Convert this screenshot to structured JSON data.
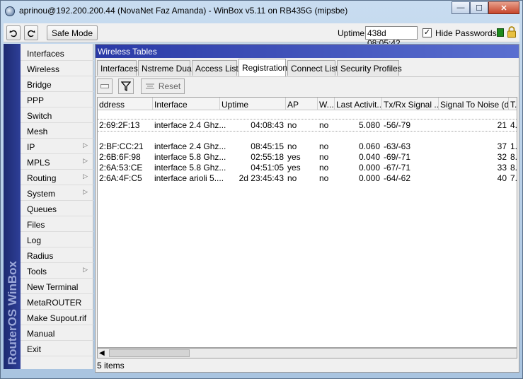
{
  "window": {
    "title": "aprinou@192.200.200.44 (NovaNet Faz Amanda) - WinBox v5.11 on RB435G (mipsbe)",
    "minimize": "—",
    "maximize": "☐",
    "close": "✕"
  },
  "toolbar": {
    "undo_icon": "undo-icon",
    "redo_icon": "redo-icon",
    "safe_mode": "Safe Mode",
    "uptime_label": "Uptime:",
    "uptime_value": "438d 08:05:42",
    "hide_passwords_checked": true,
    "hide_passwords": "Hide Passwords",
    "checkmark": "✓"
  },
  "sidebar": {
    "brand": "RouterOS WinBox",
    "items": [
      {
        "label": "Interfaces",
        "submenu": false
      },
      {
        "label": "Wireless",
        "submenu": false
      },
      {
        "label": "Bridge",
        "submenu": false
      },
      {
        "label": "PPP",
        "submenu": false
      },
      {
        "label": "Switch",
        "submenu": false
      },
      {
        "label": "Mesh",
        "submenu": false
      },
      {
        "label": "IP",
        "submenu": true
      },
      {
        "label": "MPLS",
        "submenu": true
      },
      {
        "label": "Routing",
        "submenu": true
      },
      {
        "label": "System",
        "submenu": true
      },
      {
        "label": "Queues",
        "submenu": false
      },
      {
        "label": "Files",
        "submenu": false
      },
      {
        "label": "Log",
        "submenu": false
      },
      {
        "label": "Radius",
        "submenu": false
      },
      {
        "label": "Tools",
        "submenu": true
      },
      {
        "label": "New Terminal",
        "submenu": false
      },
      {
        "label": "MetaROUTER",
        "submenu": false
      },
      {
        "label": "Make Supout.rif",
        "submenu": false
      },
      {
        "label": "Manual",
        "submenu": false
      },
      {
        "label": "Exit",
        "submenu": false
      }
    ],
    "submenu_arrow": "▷"
  },
  "panel": {
    "title": "Wireless Tables",
    "tabs": [
      "Interfaces",
      "Nstreme Dual",
      "Access List",
      "Registration",
      "Connect List",
      "Security Profiles"
    ],
    "active_tab": "Registration",
    "reset": "Reset",
    "columns": [
      "ddress",
      "Interface",
      "Uptime",
      "AP",
      "W...",
      "Last Activit...",
      "Tx/Rx Signal ...",
      "Signal To Noise (d...",
      "T..."
    ],
    "rows": [
      {
        "address": "2:69:2F:13",
        "interface": "interface 2.4 Ghz...",
        "uptime": "04:08:43",
        "ap": "no",
        "w": "no",
        "last_activity": "5.080",
        "txrx": "-56/-79",
        "snr": "21",
        "t": "4..."
      },
      {
        "address": "2:BF:CC:21",
        "interface": "interface 2.4 Ghz...",
        "uptime": "08:45:15",
        "ap": "no",
        "w": "no",
        "last_activity": "0.060",
        "txrx": "-63/-63",
        "snr": "37",
        "t": "1..."
      },
      {
        "address": "2:6B:6F:98",
        "interface": "interface 5.8 Ghz...",
        "uptime": "02:55:18",
        "ap": "yes",
        "w": "no",
        "last_activity": "0.040",
        "txrx": "-69/-71",
        "snr": "32",
        "t": "8..."
      },
      {
        "address": "2:6A:53:CE",
        "interface": "interface 5.8 Ghz...",
        "uptime": "04:51:05",
        "ap": "yes",
        "w": "no",
        "last_activity": "0.000",
        "txrx": "-67/-71",
        "snr": "33",
        "t": "8..."
      },
      {
        "address": "2:6A:4F:C5",
        "interface": "interface arioli 5....",
        "uptime": "2d 23:45:43",
        "ap": "no",
        "w": "no",
        "last_activity": "0.000",
        "txrx": "-64/-62",
        "snr": "40",
        "t": "7..."
      }
    ],
    "status": "5 items",
    "scroll_left": "◀"
  },
  "colors": {
    "title_gradient_start": "#2a3aa6",
    "brand_strip": "#1d2a70",
    "status_green": "#1c8a1c"
  }
}
